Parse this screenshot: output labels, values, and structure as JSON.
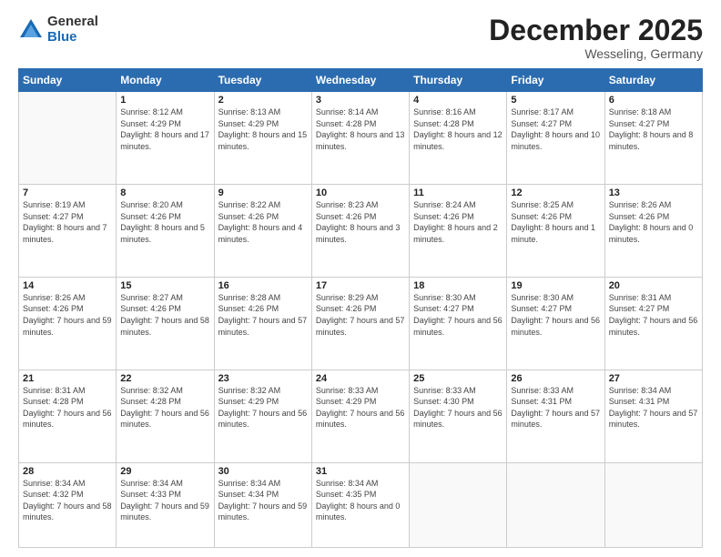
{
  "logo": {
    "general": "General",
    "blue": "Blue"
  },
  "header": {
    "month": "December 2025",
    "location": "Wesseling, Germany"
  },
  "weekdays": [
    "Sunday",
    "Monday",
    "Tuesday",
    "Wednesday",
    "Thursday",
    "Friday",
    "Saturday"
  ],
  "weeks": [
    [
      {
        "day": "",
        "sunrise": "",
        "sunset": "",
        "daylight": ""
      },
      {
        "day": "1",
        "sunrise": "Sunrise: 8:12 AM",
        "sunset": "Sunset: 4:29 PM",
        "daylight": "Daylight: 8 hours and 17 minutes."
      },
      {
        "day": "2",
        "sunrise": "Sunrise: 8:13 AM",
        "sunset": "Sunset: 4:29 PM",
        "daylight": "Daylight: 8 hours and 15 minutes."
      },
      {
        "day": "3",
        "sunrise": "Sunrise: 8:14 AM",
        "sunset": "Sunset: 4:28 PM",
        "daylight": "Daylight: 8 hours and 13 minutes."
      },
      {
        "day": "4",
        "sunrise": "Sunrise: 8:16 AM",
        "sunset": "Sunset: 4:28 PM",
        "daylight": "Daylight: 8 hours and 12 minutes."
      },
      {
        "day": "5",
        "sunrise": "Sunrise: 8:17 AM",
        "sunset": "Sunset: 4:27 PM",
        "daylight": "Daylight: 8 hours and 10 minutes."
      },
      {
        "day": "6",
        "sunrise": "Sunrise: 8:18 AM",
        "sunset": "Sunset: 4:27 PM",
        "daylight": "Daylight: 8 hours and 8 minutes."
      }
    ],
    [
      {
        "day": "7",
        "sunrise": "Sunrise: 8:19 AM",
        "sunset": "Sunset: 4:27 PM",
        "daylight": "Daylight: 8 hours and 7 minutes."
      },
      {
        "day": "8",
        "sunrise": "Sunrise: 8:20 AM",
        "sunset": "Sunset: 4:26 PM",
        "daylight": "Daylight: 8 hours and 5 minutes."
      },
      {
        "day": "9",
        "sunrise": "Sunrise: 8:22 AM",
        "sunset": "Sunset: 4:26 PM",
        "daylight": "Daylight: 8 hours and 4 minutes."
      },
      {
        "day": "10",
        "sunrise": "Sunrise: 8:23 AM",
        "sunset": "Sunset: 4:26 PM",
        "daylight": "Daylight: 8 hours and 3 minutes."
      },
      {
        "day": "11",
        "sunrise": "Sunrise: 8:24 AM",
        "sunset": "Sunset: 4:26 PM",
        "daylight": "Daylight: 8 hours and 2 minutes."
      },
      {
        "day": "12",
        "sunrise": "Sunrise: 8:25 AM",
        "sunset": "Sunset: 4:26 PM",
        "daylight": "Daylight: 8 hours and 1 minute."
      },
      {
        "day": "13",
        "sunrise": "Sunrise: 8:26 AM",
        "sunset": "Sunset: 4:26 PM",
        "daylight": "Daylight: 8 hours and 0 minutes."
      }
    ],
    [
      {
        "day": "14",
        "sunrise": "Sunrise: 8:26 AM",
        "sunset": "Sunset: 4:26 PM",
        "daylight": "Daylight: 7 hours and 59 minutes."
      },
      {
        "day": "15",
        "sunrise": "Sunrise: 8:27 AM",
        "sunset": "Sunset: 4:26 PM",
        "daylight": "Daylight: 7 hours and 58 minutes."
      },
      {
        "day": "16",
        "sunrise": "Sunrise: 8:28 AM",
        "sunset": "Sunset: 4:26 PM",
        "daylight": "Daylight: 7 hours and 57 minutes."
      },
      {
        "day": "17",
        "sunrise": "Sunrise: 8:29 AM",
        "sunset": "Sunset: 4:26 PM",
        "daylight": "Daylight: 7 hours and 57 minutes."
      },
      {
        "day": "18",
        "sunrise": "Sunrise: 8:30 AM",
        "sunset": "Sunset: 4:27 PM",
        "daylight": "Daylight: 7 hours and 56 minutes."
      },
      {
        "day": "19",
        "sunrise": "Sunrise: 8:30 AM",
        "sunset": "Sunset: 4:27 PM",
        "daylight": "Daylight: 7 hours and 56 minutes."
      },
      {
        "day": "20",
        "sunrise": "Sunrise: 8:31 AM",
        "sunset": "Sunset: 4:27 PM",
        "daylight": "Daylight: 7 hours and 56 minutes."
      }
    ],
    [
      {
        "day": "21",
        "sunrise": "Sunrise: 8:31 AM",
        "sunset": "Sunset: 4:28 PM",
        "daylight": "Daylight: 7 hours and 56 minutes."
      },
      {
        "day": "22",
        "sunrise": "Sunrise: 8:32 AM",
        "sunset": "Sunset: 4:28 PM",
        "daylight": "Daylight: 7 hours and 56 minutes."
      },
      {
        "day": "23",
        "sunrise": "Sunrise: 8:32 AM",
        "sunset": "Sunset: 4:29 PM",
        "daylight": "Daylight: 7 hours and 56 minutes."
      },
      {
        "day": "24",
        "sunrise": "Sunrise: 8:33 AM",
        "sunset": "Sunset: 4:29 PM",
        "daylight": "Daylight: 7 hours and 56 minutes."
      },
      {
        "day": "25",
        "sunrise": "Sunrise: 8:33 AM",
        "sunset": "Sunset: 4:30 PM",
        "daylight": "Daylight: 7 hours and 56 minutes."
      },
      {
        "day": "26",
        "sunrise": "Sunrise: 8:33 AM",
        "sunset": "Sunset: 4:31 PM",
        "daylight": "Daylight: 7 hours and 57 minutes."
      },
      {
        "day": "27",
        "sunrise": "Sunrise: 8:34 AM",
        "sunset": "Sunset: 4:31 PM",
        "daylight": "Daylight: 7 hours and 57 minutes."
      }
    ],
    [
      {
        "day": "28",
        "sunrise": "Sunrise: 8:34 AM",
        "sunset": "Sunset: 4:32 PM",
        "daylight": "Daylight: 7 hours and 58 minutes."
      },
      {
        "day": "29",
        "sunrise": "Sunrise: 8:34 AM",
        "sunset": "Sunset: 4:33 PM",
        "daylight": "Daylight: 7 hours and 59 minutes."
      },
      {
        "day": "30",
        "sunrise": "Sunrise: 8:34 AM",
        "sunset": "Sunset: 4:34 PM",
        "daylight": "Daylight: 7 hours and 59 minutes."
      },
      {
        "day": "31",
        "sunrise": "Sunrise: 8:34 AM",
        "sunset": "Sunset: 4:35 PM",
        "daylight": "Daylight: 8 hours and 0 minutes."
      },
      {
        "day": "",
        "sunrise": "",
        "sunset": "",
        "daylight": ""
      },
      {
        "day": "",
        "sunrise": "",
        "sunset": "",
        "daylight": ""
      },
      {
        "day": "",
        "sunrise": "",
        "sunset": "",
        "daylight": ""
      }
    ]
  ]
}
